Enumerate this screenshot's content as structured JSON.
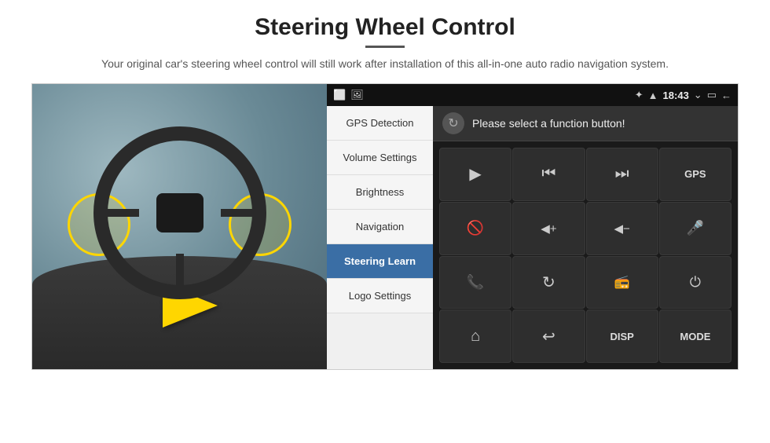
{
  "page": {
    "title": "Steering Wheel Control",
    "divider": true,
    "subtitle": "Your original car's steering wheel control will still work after installation of this all-in-one auto radio navigation system."
  },
  "status_bar": {
    "left_icons": [
      "⬜",
      "🖼"
    ],
    "bluetooth": "⬡",
    "wifi": "▲",
    "time": "18:43",
    "expand": "⌄",
    "battery": "▭",
    "back": "←"
  },
  "menu": {
    "items": [
      {
        "id": "gps-detection",
        "label": "GPS Detection",
        "active": false
      },
      {
        "id": "volume-settings",
        "label": "Volume Settings",
        "active": false
      },
      {
        "id": "brightness",
        "label": "Brightness",
        "active": false
      },
      {
        "id": "navigation",
        "label": "Navigation",
        "active": false
      },
      {
        "id": "steering-learn",
        "label": "Steering Learn",
        "active": true
      },
      {
        "id": "logo-settings",
        "label": "Logo Settings",
        "active": false
      }
    ]
  },
  "function_panel": {
    "header_text": "Please select a function button!",
    "buttons": [
      {
        "id": "play",
        "symbol": "▶",
        "type": "icon"
      },
      {
        "id": "prev",
        "symbol": "⏮",
        "type": "icon"
      },
      {
        "id": "next",
        "symbol": "⏭",
        "type": "icon"
      },
      {
        "id": "gps",
        "symbol": "GPS",
        "type": "text"
      },
      {
        "id": "mute",
        "symbol": "🚫",
        "type": "icon"
      },
      {
        "id": "vol-up",
        "symbol": "🔊+",
        "type": "icon"
      },
      {
        "id": "vol-down",
        "symbol": "🔊-",
        "type": "icon"
      },
      {
        "id": "mic",
        "symbol": "🎤",
        "type": "icon"
      },
      {
        "id": "phone",
        "symbol": "📞",
        "type": "icon"
      },
      {
        "id": "rotate",
        "symbol": "↻",
        "type": "icon"
      },
      {
        "id": "radio",
        "symbol": "📻",
        "type": "icon"
      },
      {
        "id": "power",
        "symbol": "⏻",
        "type": "icon"
      },
      {
        "id": "home",
        "symbol": "⌂",
        "type": "icon"
      },
      {
        "id": "back2",
        "symbol": "↩",
        "type": "icon"
      },
      {
        "id": "disp",
        "symbol": "DISP",
        "type": "text"
      },
      {
        "id": "mode",
        "symbol": "MODE",
        "type": "text"
      }
    ]
  }
}
